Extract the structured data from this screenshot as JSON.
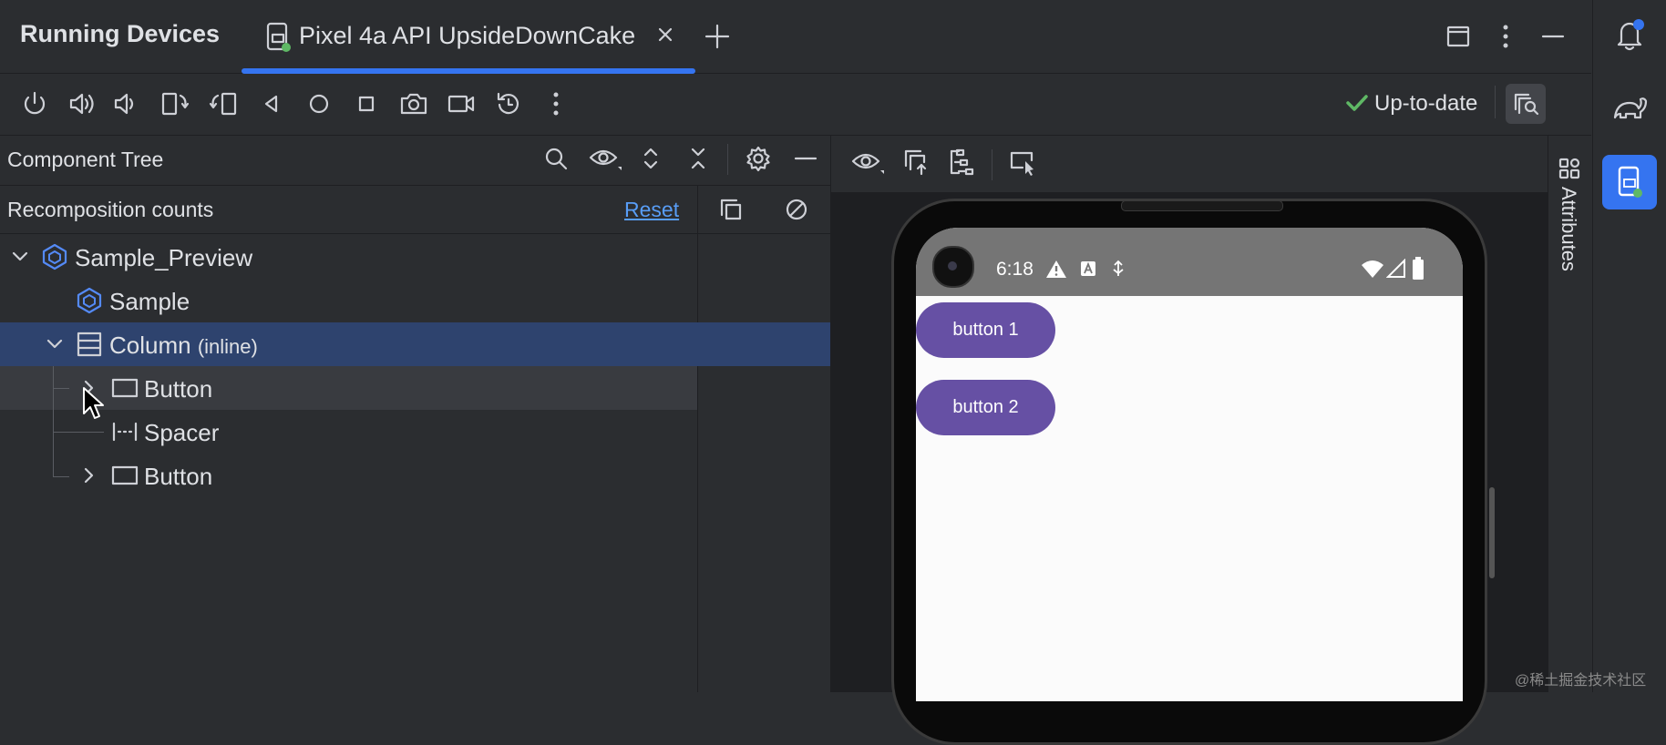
{
  "window": {
    "title": "Running Devices",
    "tab_label": "Pixel 4a API UpsideDownCake"
  },
  "toolbar": {
    "status_label": "Up-to-date",
    "icons": [
      "power-icon",
      "volume-up-icon",
      "volume-down-icon",
      "rotate-left-icon",
      "rotate-right-icon",
      "back-icon",
      "home-icon",
      "overview-icon",
      "screenshot-icon",
      "screen-record-icon",
      "reset-icon",
      "more-icon"
    ]
  },
  "component_tree": {
    "title": "Component Tree",
    "recomposition_label": "Recomposition counts",
    "reset_label": "Reset",
    "nodes": [
      {
        "label": "Sample_Preview",
        "suffix": "",
        "icon": "compose-cube-icon"
      },
      {
        "label": "Sample",
        "suffix": "",
        "icon": "compose-cube-icon"
      },
      {
        "label": "Column",
        "suffix": "(inline)",
        "icon": "column-layout-icon",
        "selected": true
      },
      {
        "label": "Button",
        "suffix": "",
        "icon": "button-icon",
        "hovered": true
      },
      {
        "label": "Spacer",
        "suffix": "",
        "icon": "spacer-icon"
      },
      {
        "label": "Button",
        "suffix": "",
        "icon": "button-icon"
      }
    ]
  },
  "attributes_panel": {
    "label": "Attributes"
  },
  "device": {
    "status_time": "6:18",
    "buttons": [
      "button 1",
      "button 2"
    ]
  },
  "colors": {
    "accent": "#3574f0",
    "selection": "#2e436e",
    "hover": "#393b40",
    "device_button": "#6650a4",
    "status_ok": "#5fb865"
  },
  "watermark": "@稀土掘金技术社区"
}
